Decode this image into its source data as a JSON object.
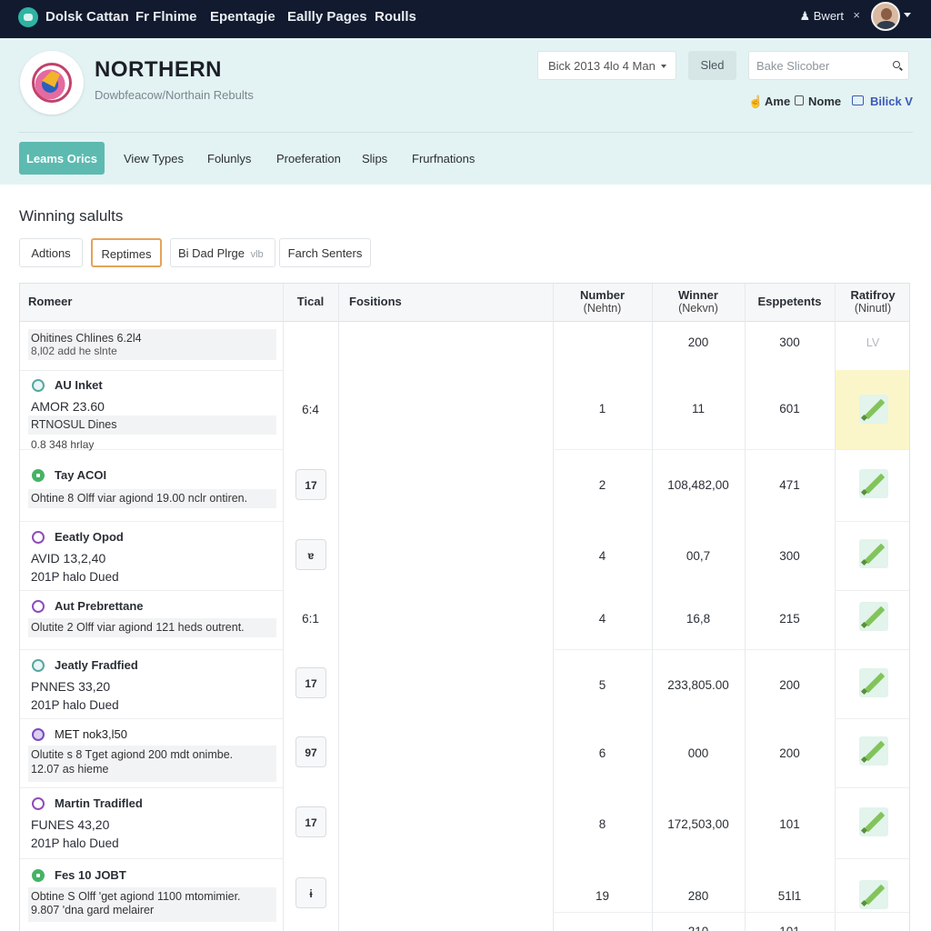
{
  "topnav": {
    "items": [
      "Dolsk Cattan",
      "Fr Flnime",
      "Epentagie",
      "Eallly Pages",
      "Roulls"
    ],
    "user_name": "Bwert",
    "user_close": "×"
  },
  "header": {
    "brand_title": "NORTHERN",
    "brand_subtitle": "Dowbfeacow/Northain Rebults",
    "select_value": "Bick 2013 4lo 4 Man",
    "sled_button": "Sled",
    "search_placeholder": "Bake Slicober",
    "opt_ame": "Ame",
    "opt_nome": "Nome",
    "opt_bilick": "Bilick V"
  },
  "tabs": [
    "Leams Orics",
    "View Types",
    "Folunlys",
    "Proeferation",
    "Slips",
    "Frurfnations"
  ],
  "section": {
    "title": "Winning salults",
    "filters": [
      "Adtions",
      "Reptimes",
      "Bi Dad Plrge",
      "vlb",
      "Farch Senters"
    ]
  },
  "table": {
    "headers": {
      "romeer": "Romeer",
      "tical": "Tical",
      "fositions": "Fositions",
      "number": "Number",
      "number_sub": "(Nehtn)",
      "winner": "Winner",
      "winner_sub": "(Nekvn)",
      "espetents": "Esppetents",
      "ratifroy": "Ratifroy",
      "ratifroy_sub": "(Ninutl)"
    },
    "rows": [
      {
        "line1": "Ohitines Chlines 6.2l4",
        "line2": "8,l02 add he slnte",
        "number": "",
        "winner": "200",
        "esp": "300",
        "rat": "LV"
      },
      {
        "name": "AU Inket",
        "line1": "AMOR  23.60",
        "line2": "RTNOSUL Dines",
        "line3": "0.8 348 hrlay",
        "tical": "6:4",
        "number": "1",
        "winner": "11",
        "esp": "601"
      },
      {
        "name": "Tay ACOI",
        "line1": "Ohtine 8 Olff viar agiond 19.00 nclr ontiren.",
        "tical": "17",
        "number": "2",
        "winner": "108,482,00",
        "esp": "471"
      },
      {
        "name": "Eeatly Opod",
        "line1": "AVID 13,2,40",
        "line2": "201P halo Dued",
        "tical": "ɐ",
        "number": "4",
        "winner": "00,7",
        "esp": "300"
      },
      {
        "name": "Aut Prebrettane",
        "line1": "Olutite 2 Olff viar agiond 121 heds outrent.",
        "tical": "6:1",
        "number": "4",
        "winner": "16,8",
        "esp": "215"
      },
      {
        "name": "Jeatly Fradfied",
        "line1": "PNNES 33,20",
        "line2": "201P halo Dued",
        "tical": "17",
        "number": "5",
        "winner": "233,805.00",
        "esp": "200"
      },
      {
        "name": "MET nok3,l50",
        "line1": "Olutite s 8 Tget agiond 200 mdt onimbe.",
        "line2": "12.07  as hieme",
        "tical": "97",
        "number": "6",
        "winner": "000",
        "esp": "200"
      },
      {
        "name": "Martin Tradifled",
        "line1": "FUNES 43,20",
        "line2": "201P halo Dued",
        "tical": "17",
        "number": "8",
        "winner": "172,503,00",
        "esp": "101"
      },
      {
        "name": "Fes 10 JOBT",
        "line1": "Obtine S Olff 'get agiond 1100 mtomimier.",
        "line2": "9.807 'dna gard melairer",
        "tical": "ɨ",
        "number": "19",
        "winner": "280",
        "esp": "51l1"
      },
      {
        "number": "",
        "winner": "210",
        "esp": "101"
      }
    ]
  },
  "colors": {
    "nav_bg": "#111a2e",
    "band_bg": "#e3f3f3",
    "tab_active": "#5dbab0",
    "edit_green": "#82c45a",
    "highlight": "#fbf6c9"
  }
}
